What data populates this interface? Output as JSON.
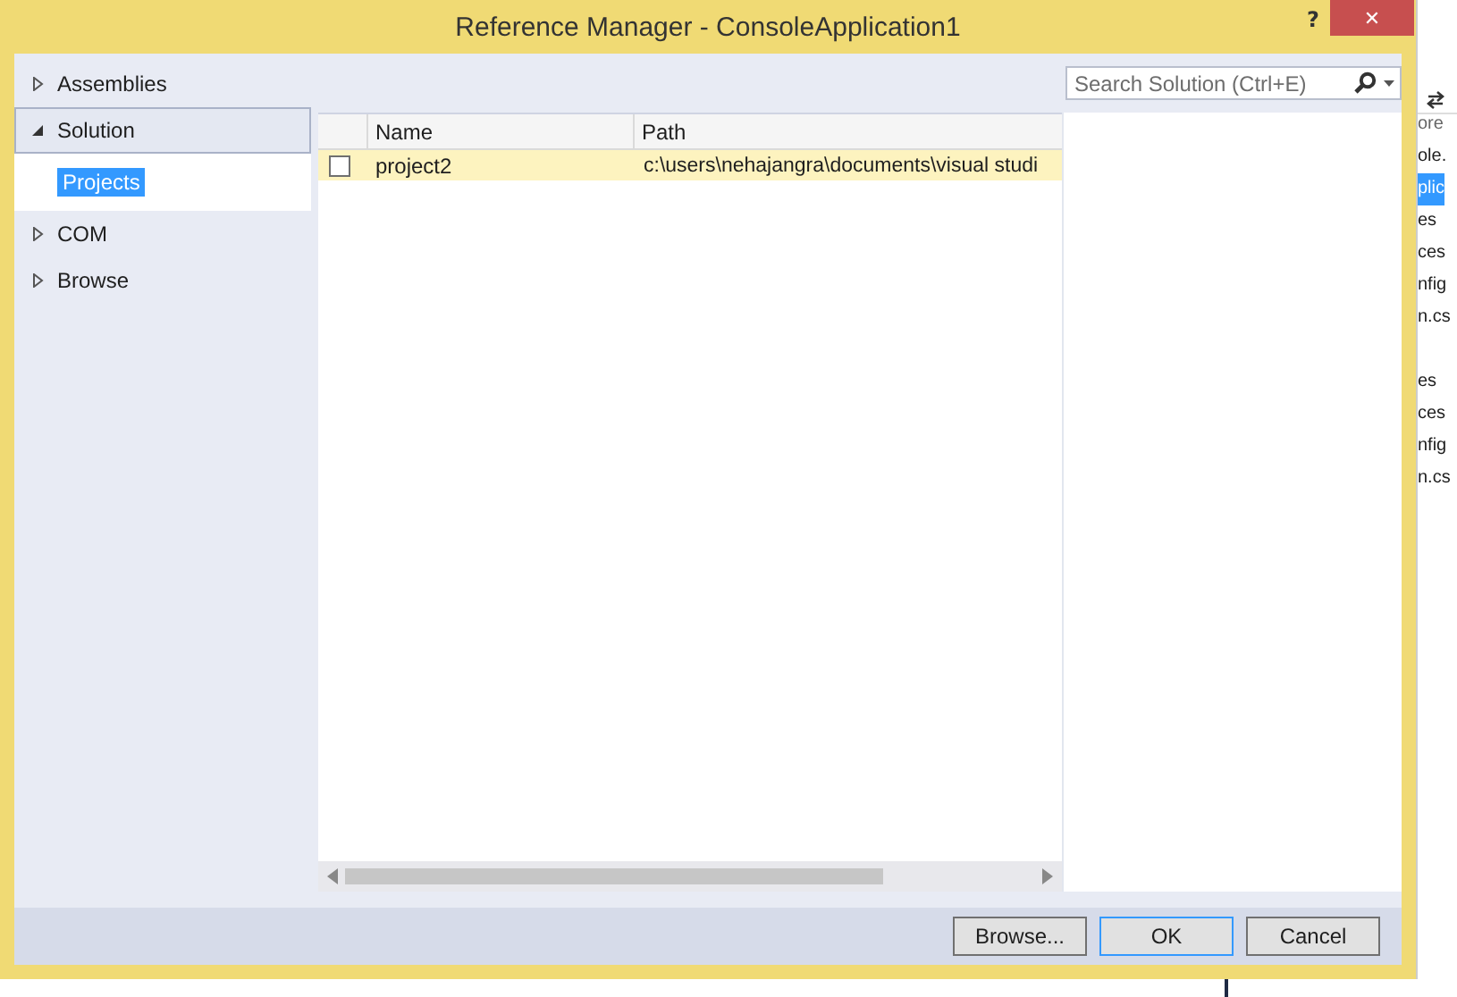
{
  "window": {
    "title": "Reference Manager - ConsoleApplication1",
    "help": "?",
    "close": "✕"
  },
  "sidebar": {
    "items": [
      {
        "label": "Assemblies",
        "expanded": false,
        "selected": false
      },
      {
        "label": "Solution",
        "expanded": true,
        "selected": true,
        "children": [
          {
            "label": "Projects",
            "selected": true
          }
        ]
      },
      {
        "label": "COM",
        "expanded": false,
        "selected": false
      },
      {
        "label": "Browse",
        "expanded": false,
        "selected": false
      }
    ]
  },
  "search": {
    "placeholder": "Search Solution (Ctrl+E)"
  },
  "table": {
    "columns": [
      "Name",
      "Path"
    ],
    "rows": [
      {
        "checked": false,
        "selected": true,
        "name": "project2",
        "path": "c:\\users\\nehajangra\\documents\\visual studi"
      }
    ]
  },
  "buttons": [
    {
      "label": "Browse...",
      "default": false
    },
    {
      "label": "OK",
      "default": true
    },
    {
      "label": "Cancel",
      "default": false
    }
  ],
  "background_panel": {
    "search_text": "ore",
    "items": [
      {
        "label": "ole.",
        "selected": false
      },
      {
        "label": "plic",
        "selected": true
      },
      {
        "label": "es",
        "selected": false
      },
      {
        "label": "ces",
        "selected": false
      },
      {
        "label": "nfig",
        "selected": false
      },
      {
        "label": "n.cs",
        "selected": false
      },
      {
        "label": "es",
        "selected": false
      },
      {
        "label": "ces",
        "selected": false
      },
      {
        "label": "nfig",
        "selected": false
      },
      {
        "label": "n.cs",
        "selected": false
      }
    ]
  }
}
